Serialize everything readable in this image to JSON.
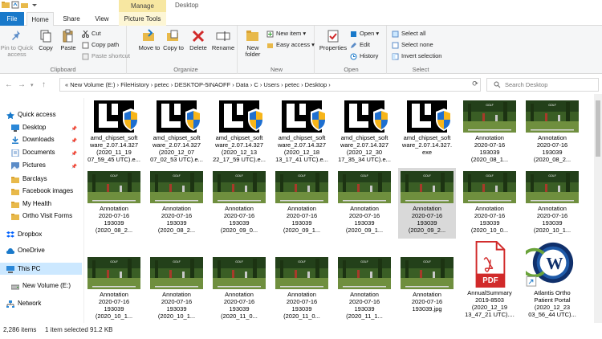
{
  "window": {
    "title": "Desktop",
    "manage_tab": "Manage",
    "window_controls": [
      "minimize-icon",
      "maximize-icon",
      "close-icon"
    ]
  },
  "tabs": {
    "file": "File",
    "home": "Home",
    "share": "Share",
    "view": "View",
    "picture_tools": "Picture Tools"
  },
  "ribbon": {
    "clipboard": {
      "label": "Clipboard",
      "pin": "Pin to Quick access",
      "copy": "Copy",
      "paste": "Paste",
      "cut": "Cut",
      "copy_path": "Copy path",
      "paste_shortcut": "Paste shortcut"
    },
    "organize": {
      "label": "Organize",
      "move_to": "Move to",
      "copy_to": "Copy to",
      "delete": "Delete",
      "rename": "Rename"
    },
    "new": {
      "label": "New",
      "new_folder": "New folder",
      "new_item": "New item ▾",
      "easy_access": "Easy access ▾"
    },
    "open": {
      "label": "Open",
      "properties": "Properties",
      "open": "Open ▾",
      "edit": "Edit",
      "history": "History"
    },
    "select": {
      "label": "Select",
      "select_all": "Select all",
      "select_none": "Select none",
      "invert": "Invert selection"
    }
  },
  "address": {
    "path": "« New Volume (E:)  ›  FileHistory  ›  petec  ›  DESKTOP-5INAOFF  ›  Data  ›  C  ›  Users  ›  petec  ›  Desktop  ›",
    "search_placeholder": "Search Desktop"
  },
  "nav": [
    {
      "label": "Quick access",
      "icon": "star-icon",
      "pinned": false
    },
    {
      "label": "Desktop",
      "icon": "desktop-icon",
      "pinned": true
    },
    {
      "label": "Downloads",
      "icon": "download-icon",
      "pinned": true
    },
    {
      "label": "Documents",
      "icon": "documents-icon",
      "pinned": true
    },
    {
      "label": "Pictures",
      "icon": "pictures-icon",
      "pinned": true
    },
    {
      "label": "Barclays",
      "icon": "folder-icon",
      "pinned": false
    },
    {
      "label": "Facebook images",
      "icon": "folder-icon",
      "pinned": false
    },
    {
      "label": "My Health",
      "icon": "folder-icon",
      "pinned": false
    },
    {
      "label": "Ortho Visit Forms",
      "icon": "folder-icon",
      "pinned": false
    },
    {
      "label": "Dropbox",
      "icon": "dropbox-icon",
      "pinned": false
    },
    {
      "label": "OneDrive",
      "icon": "cloud-icon",
      "pinned": false
    },
    {
      "label": "This PC",
      "icon": "pc-icon",
      "pinned": false
    },
    {
      "label": "New Volume (E:)",
      "icon": "drive-icon",
      "pinned": false
    },
    {
      "label": "Network",
      "icon": "network-icon",
      "pinned": false
    }
  ],
  "files": [
    {
      "name": "amd_chipset_soft\nware_2.07.14.327\n(2020_11_19\n07_59_45 UTC).e...",
      "type": "installer"
    },
    {
      "name": "amd_chipset_soft\nware_2.07.14.327\n(2020_12_07\n07_02_53 UTC).e...",
      "type": "installer"
    },
    {
      "name": "amd_chipset_soft\nware_2.07.14.327\n(2020_12_13\n22_17_59 UTC).e...",
      "type": "installer"
    },
    {
      "name": "amd_chipset_soft\nware_2.07.14.327\n(2020_12_18\n13_17_41 UTC).e...",
      "type": "installer"
    },
    {
      "name": "amd_chipset_soft\nware_2.07.14.327\n(2020_12_30\n17_35_34 UTC).e...",
      "type": "installer"
    },
    {
      "name": "amd_chipset_soft\nware_2.07.14.327.\nexe",
      "type": "installer"
    },
    {
      "name": "Annotation\n2020-07-16\n193039\n(2020_08_1...",
      "type": "photo"
    },
    {
      "name": "Annotation\n2020-07-16\n193039\n(2020_08_2...",
      "type": "photo"
    },
    {
      "name": "Annotation\n2020-07-16\n193039\n(2020_08_2...",
      "type": "photo"
    },
    {
      "name": "Annotation\n2020-07-16\n193039\n(2020_08_2...",
      "type": "photo"
    },
    {
      "name": "Annotation\n2020-07-16\n193039\n(2020_09_0...",
      "type": "photo"
    },
    {
      "name": "Annotation\n2020-07-16\n193039\n(2020_09_1...",
      "type": "photo"
    },
    {
      "name": "Annotation\n2020-07-16\n193039\n(2020_09_1...",
      "type": "photo"
    },
    {
      "name": "Annotation\n2020-07-16\n193039\n(2020_09_2...",
      "type": "photo"
    },
    {
      "name": "Annotation\n2020-07-16\n193039\n(2020_10_0...",
      "type": "photo"
    },
    {
      "name": "Annotation\n2020-07-16\n193039\n(2020_10_1...",
      "type": "photo"
    },
    {
      "name": "Annotation\n2020-07-16\n193039\n(2020_10_1...",
      "type": "photo"
    },
    {
      "name": "Annotation\n2020-07-16\n193039\n(2020_10_1...",
      "type": "photo"
    },
    {
      "name": "Annotation\n2020-07-16\n193039\n(2020_11_0...",
      "type": "photo"
    },
    {
      "name": "Annotation\n2020-07-16\n193039\n(2020_11_0...",
      "type": "photo"
    },
    {
      "name": "Annotation\n2020-07-16\n193039\n(2020_11_1...",
      "type": "photo"
    },
    {
      "name": "Annotation\n2020-07-16\n193039.jpg",
      "type": "photo"
    },
    {
      "name": "AnnualSummary\n2019-8503\n(2020_12_19\n13_47_21 UTC)....",
      "type": "pdf"
    },
    {
      "name": "Atlantis Ortho\nPatient Portal\n(2020_12_23\n03_56_44 UTC)...",
      "type": "shortcut"
    }
  ],
  "pdf_badge": "PDF",
  "shortcut_badge": "W",
  "photo_caption": "GOLF",
  "status": {
    "count": "2,286 items",
    "selected": "1 item selected  91.2 KB"
  },
  "colors": {
    "accent": "#1979ca",
    "selection": "#cce8ff",
    "manage": "#f7e7a1"
  }
}
